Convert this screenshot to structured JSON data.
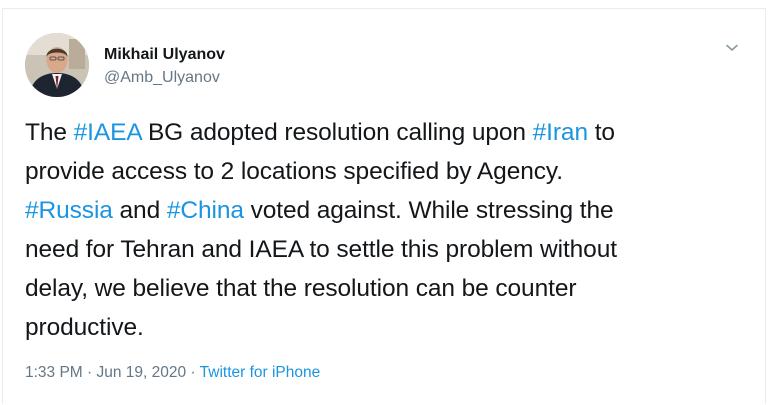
{
  "author": {
    "name": "Mikhail Ulyanov",
    "handle": "@Amb_Ulyanov"
  },
  "icons": {
    "menu": "chevron-down-icon"
  },
  "tweet": {
    "l1_a": "The ",
    "l1_tag1": "#IAEA",
    "l1_b": " BG adopted resolution calling upon ",
    "l1_tag2": "#Iran",
    "l1_c": " to",
    "l2": "provide access to 2 locations specified by Agency.",
    "l3_tag1": "#Russia",
    "l3_a": " and ",
    "l3_tag2": "#China",
    "l3_b": " voted against. While stressing the",
    "l4": "need for Tehran and IAEA to settle this problem without",
    "l5": "delay, we believe that the resolution can be counter",
    "l6": "productive."
  },
  "meta": {
    "timestamp": "1:33 PM · Jun 19, 2020",
    "separator": " · ",
    "source": "Twitter for iPhone"
  },
  "colors": {
    "hashtag": "#1b95e0",
    "text": "#14171a",
    "muted": "#657786"
  }
}
